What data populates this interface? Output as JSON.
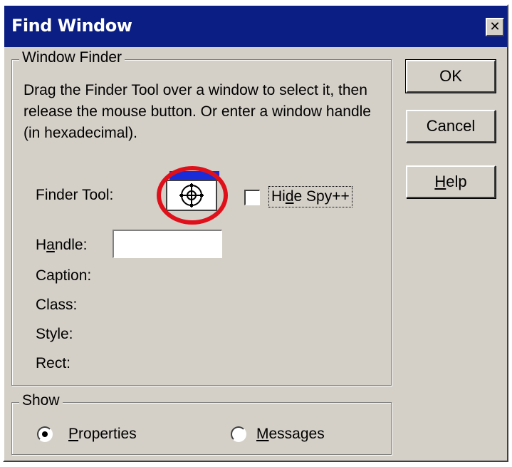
{
  "window": {
    "title": "Find Window",
    "close_glyph": "✕"
  },
  "finder_group": {
    "legend": "Window Finder",
    "instructions": "Drag the Finder Tool over a window to select it, then release the mouse button.  Or enter a window handle (in hexadecimal).",
    "finder_tool_label": "Finder Tool:",
    "finder_tool_icon": "crosshair-target-icon",
    "hide_spy_label_pre": "Hi",
    "hide_spy_label_accel": "d",
    "hide_spy_label_post": "e Spy++",
    "hide_spy_checked": false,
    "handle_label_pre": "H",
    "handle_label_accel": "a",
    "handle_label_post": "ndle:",
    "handle_value": "",
    "caption_label": "Caption:",
    "class_label": "Class:",
    "style_label": "Style:",
    "rect_label": "Rect:"
  },
  "buttons": {
    "ok": "OK",
    "cancel": "Cancel",
    "help_accel": "H",
    "help_rest": "elp"
  },
  "show_group": {
    "legend": "Show",
    "properties_accel": "P",
    "properties_rest": "roperties",
    "properties_selected": true,
    "messages_accel": "M",
    "messages_rest": "essages",
    "messages_selected": false
  },
  "colors": {
    "titlebar": "#0a1e84",
    "dialog_face": "#d4d0c8",
    "highlight_circle": "#e0101a"
  }
}
